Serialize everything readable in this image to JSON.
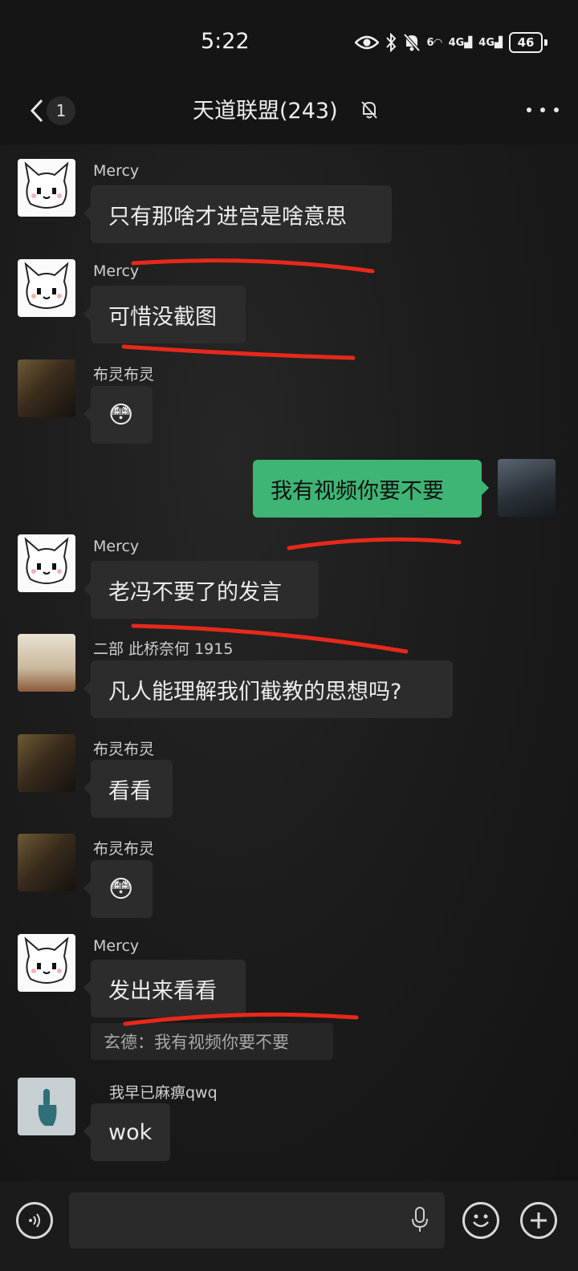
{
  "status": {
    "time": "5:22",
    "battery": "46",
    "net1": "4G",
    "net2": "4G",
    "wifi": "6"
  },
  "header": {
    "unread": "1",
    "title": "天道联盟(243)"
  },
  "messages": [
    {
      "sender": "Mercy",
      "text": "只有那啥才进宫是啥意思"
    },
    {
      "sender": "Mercy",
      "text": "可惜没截图"
    },
    {
      "sender": "布灵布灵",
      "text": "😳"
    },
    {
      "sender": "",
      "text": "我有视频你要不要"
    },
    {
      "sender": "Mercy",
      "text": "老冯不要了的发言"
    },
    {
      "sender": "二部 此桥奈何 1915",
      "text": "凡人能理解我们截教的思想吗?"
    },
    {
      "sender": "布灵布灵",
      "text": "看看"
    },
    {
      "sender": "布灵布灵",
      "text": "😳"
    },
    {
      "sender": "Mercy",
      "text": "发出来看看",
      "quote": "玄德：我有视频你要不要"
    },
    {
      "sender": "我早已麻痹qwq",
      "text": "wok"
    }
  ],
  "input": {
    "value": ""
  },
  "colors": {
    "background": "#171717",
    "bubble_other": "#2c2c2c",
    "bubble_mine": "#3eb574",
    "annotation": "#e8281c"
  }
}
